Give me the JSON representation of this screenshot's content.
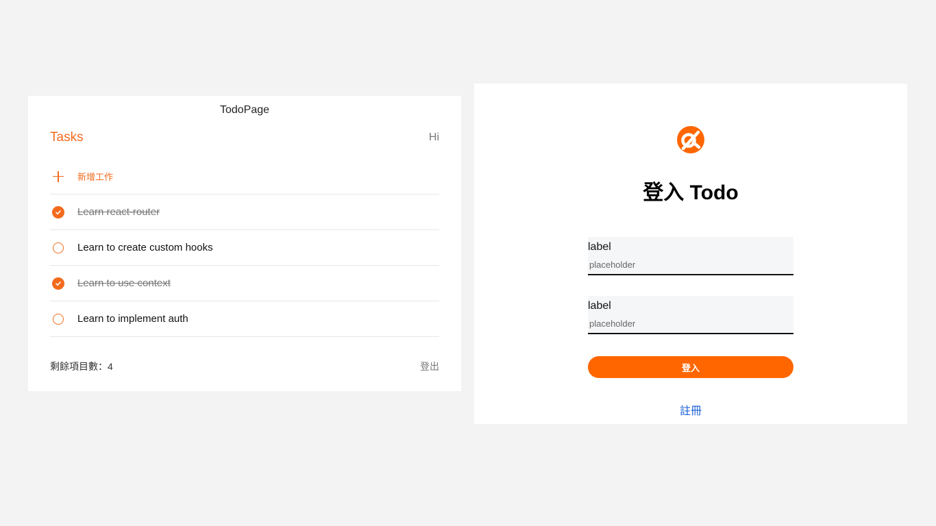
{
  "todo": {
    "page_title": "TodoPage",
    "tasks_heading": "Tasks",
    "greeting": "Hi",
    "add_label": "新增工作",
    "items": [
      {
        "text": "Learn react-router",
        "done": true
      },
      {
        "text": "Learn to create custom hooks",
        "done": false
      },
      {
        "text": "Learn to use context",
        "done": true
      },
      {
        "text": "Learn to implement auth",
        "done": false
      }
    ],
    "footer": {
      "remaining": "剩餘項目數：4",
      "logout": "登出"
    },
    "accent_color": "#f26b1d"
  },
  "login": {
    "title": "登入 Todo",
    "fields": [
      {
        "label": "label",
        "placeholder": "placeholder"
      },
      {
        "label": "label",
        "placeholder": "placeholder"
      }
    ],
    "submit_label": "登入",
    "register_label": "註冊",
    "button_color": "#ff6600",
    "link_color": "#1a5fd6"
  }
}
